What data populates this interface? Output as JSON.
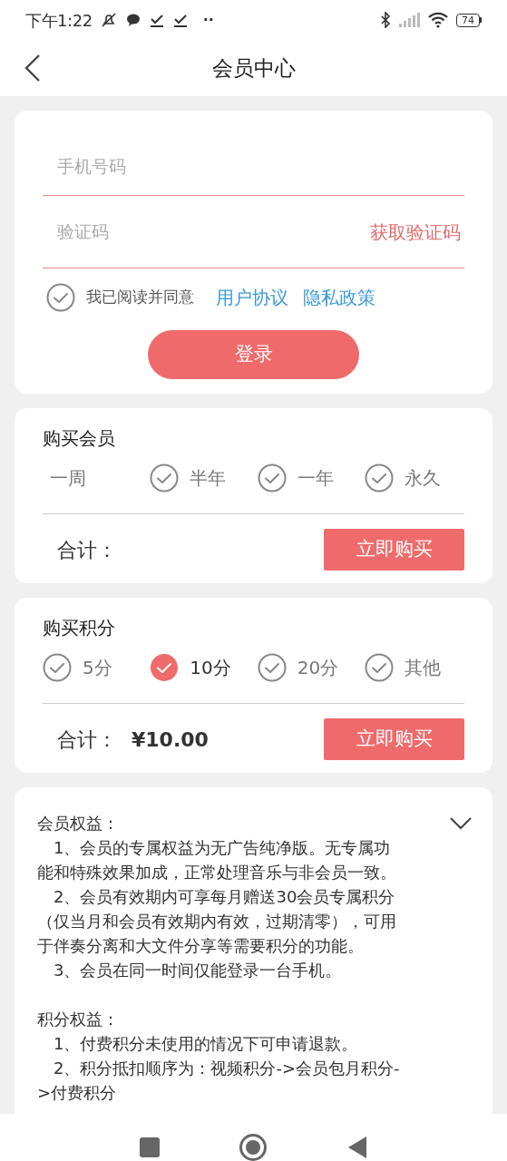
{
  "status_bar": {
    "time": "下午1:22",
    "dots": "··",
    "battery": "74"
  },
  "header": {
    "title": "会员中心"
  },
  "login": {
    "phone": {
      "placeholder": "手机号码"
    },
    "code": {
      "placeholder": "验证码"
    },
    "get_code": "获取验证码",
    "agree": {
      "checked": false,
      "text": "我已阅读并同意",
      "links": [
        "用户协议",
        "隐私政策"
      ]
    },
    "button": "登录"
  },
  "membership": {
    "title": "购买会员",
    "options": [
      {
        "label": "一周",
        "kind": "plain",
        "selected": false
      },
      {
        "label": "半年",
        "kind": "check",
        "selected": false
      },
      {
        "label": "一年",
        "kind": "check",
        "selected": false
      },
      {
        "label": "永久",
        "kind": "check",
        "selected": false
      }
    ],
    "total_label": "合计：",
    "buy": "立即购买"
  },
  "points": {
    "title": "购买积分",
    "options": [
      {
        "label": "5分",
        "kind": "check",
        "selected": false
      },
      {
        "label": "10分",
        "kind": "check",
        "selected": true
      },
      {
        "label": "20分",
        "kind": "check",
        "selected": false
      },
      {
        "label": "其他",
        "kind": "check",
        "selected": false
      }
    ],
    "total_label": "合计：",
    "total": "¥10.00",
    "buy": "立即购买"
  },
  "benefits": {
    "expanded": false,
    "sections": [
      {
        "title": "会员权益：",
        "items": [
          "1、会员的专属权益为无广告纯净版。无专属功能和特殊效果加成，正常处理音乐与非会员一致。",
          "2、会员有效期内可享每月赠送30会员专属积分（仅当月和会员有效期内有效，过期清零），可用于伴奏分离和大文件分享等需要积分的功能。",
          "3、会员在同一时间仅能登录一台手机。"
        ]
      },
      {
        "title": "积分权益：",
        "items": [
          "1、付费积分未使用的情况下可申请退款。",
          "2、积分抵扣顺序为：视频积分->会员包月积分->付费积分"
        ]
      }
    ]
  }
}
